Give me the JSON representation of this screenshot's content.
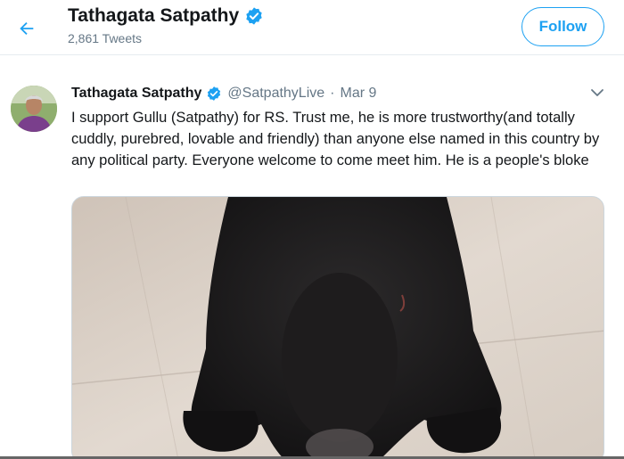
{
  "header": {
    "name": "Tathagata Satpathy",
    "tweet_count": "2,861 Tweets",
    "follow_label": "Follow"
  },
  "tweet": {
    "name": "Tathagata Satpathy",
    "handle": "@SatpathyLive",
    "separator": "·",
    "date": "Mar 9",
    "text": "I support Gullu (Satpathy) for RS. Trust me, he is more trustworthy(and totally cuddly, purebred, lovable and friendly) than anyone else named in this country by any political party. Everyone welcome to come meet him. He is a people's bloke"
  },
  "icons": {
    "back": "back-arrow-icon",
    "verified": "verified-badge-icon",
    "caret": "chevron-down-icon"
  },
  "colors": {
    "accent": "#1da1f2",
    "secondary_text": "#657786",
    "divider": "#e6ecf0"
  }
}
